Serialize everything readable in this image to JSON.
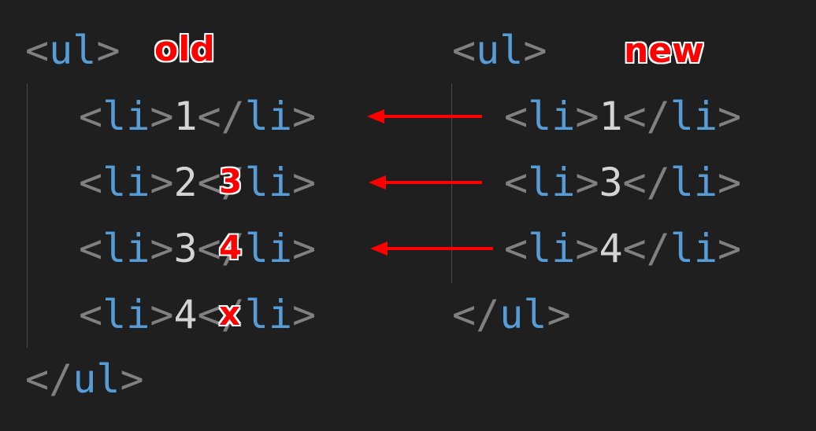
{
  "old": {
    "open": {
      "lt": "<",
      "tag": "ul",
      "gt": ">"
    },
    "label": "old",
    "items": [
      {
        "lt": "<",
        "tag": "li",
        "gt": ">",
        "text": "1",
        "close_lt": "</",
        "close_tag": "li",
        "close_gt": ">"
      },
      {
        "lt": "<",
        "tag": "li",
        "gt": ">",
        "text": "2",
        "close_lt": "</",
        "close_tag": "li",
        "close_gt": ">"
      },
      {
        "lt": "<",
        "tag": "li",
        "gt": ">",
        "text": "3",
        "close_lt": "</",
        "close_tag": "li",
        "close_gt": ">"
      },
      {
        "lt": "<",
        "tag": "li",
        "gt": ">",
        "text": "4",
        "close_lt": "</",
        "close_tag": "li",
        "close_gt": ">"
      }
    ],
    "close": {
      "lt": "</",
      "tag": "ul",
      "gt": ">"
    },
    "overlays": [
      "3",
      "4",
      "x"
    ]
  },
  "new": {
    "open": {
      "lt": "<",
      "tag": "ul",
      "gt": ">"
    },
    "label": "new",
    "items": [
      {
        "lt": "<",
        "tag": "li",
        "gt": ">",
        "text": "1",
        "close_lt": "</",
        "close_tag": "li",
        "close_gt": ">"
      },
      {
        "lt": "<",
        "tag": "li",
        "gt": ">",
        "text": "3",
        "close_lt": "</",
        "close_tag": "li",
        "close_gt": ">"
      },
      {
        "lt": "<",
        "tag": "li",
        "gt": ">",
        "text": "4",
        "close_lt": "</",
        "close_tag": "li",
        "close_gt": ">"
      }
    ],
    "close": {
      "lt": "</",
      "tag": "ul",
      "gt": ">"
    }
  },
  "colors": {
    "background": "#1f1f1f",
    "punctuation": "#808080",
    "tag": "#569cd6",
    "text": "#d4d4d4",
    "annotation": "#ff0000"
  }
}
